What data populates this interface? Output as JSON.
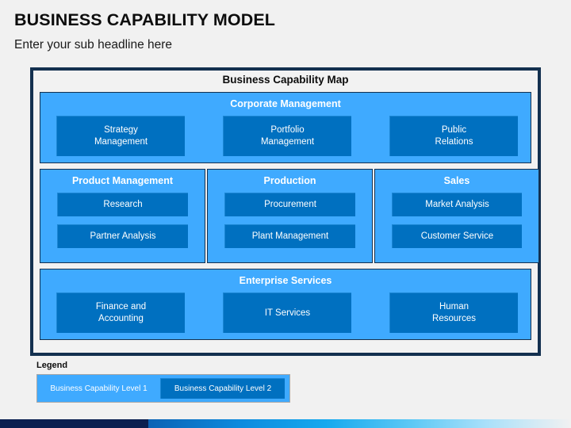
{
  "slide": {
    "title": "BUSINESS CAPABILITY MODEL",
    "subtitle": "Enter your sub headline here"
  },
  "diagram": {
    "heading": "Business Capability Map",
    "rows": [
      {
        "id": "corporate",
        "title": "Corporate Management",
        "cards": [
          "Strategy\nManagement",
          "Portfolio\nManagement",
          "Public\nRelations"
        ]
      },
      {
        "id": "middle",
        "sections": [
          {
            "id": "product",
            "title": "Product Management",
            "cards": [
              "Research",
              "Partner Analysis"
            ]
          },
          {
            "id": "production",
            "title": "Production",
            "cards": [
              "Procurement",
              "Plant Management"
            ]
          },
          {
            "id": "sales",
            "title": "Sales",
            "cards": [
              "Market Analysis",
              "Customer Service"
            ]
          }
        ]
      },
      {
        "id": "enterprise",
        "title": "Enterprise Services",
        "cards": [
          "Finance and\nAccounting",
          "IT Services",
          "Human\nResources"
        ]
      }
    ]
  },
  "legend": {
    "label": "Legend",
    "level1": "Business Capability Level 1",
    "level2": "Business Capability Level 2"
  },
  "colors": {
    "level1_fill": "#3FAAFF",
    "level2_fill": "#0070C0",
    "frame_border": "#13304F",
    "slide_background": "#F1F1F1",
    "band_navy": "#0A2050"
  }
}
